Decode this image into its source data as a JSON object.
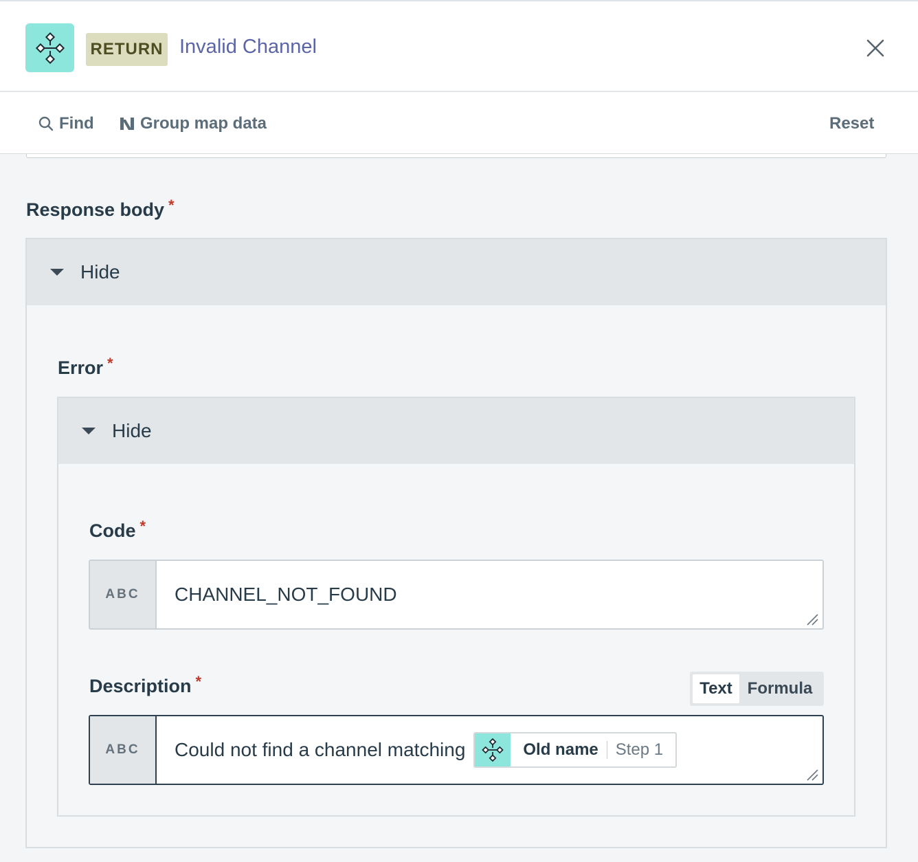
{
  "header": {
    "badge": "RETURN",
    "title": "Invalid Channel"
  },
  "toolbar": {
    "find_label": "Find",
    "group_label": "Group map data",
    "reset_label": "Reset"
  },
  "response_body": {
    "label": "Response body",
    "required_mark": "*",
    "toggle_label": "Hide",
    "error": {
      "label": "Error",
      "required_mark": "*",
      "toggle_label": "Hide",
      "code": {
        "label": "Code",
        "required_mark": "*",
        "type_tag": "ABC",
        "value": "CHANNEL_NOT_FOUND"
      },
      "description": {
        "label": "Description",
        "required_mark": "*",
        "type_tag": "ABC",
        "mode_options": [
          "Text",
          "Formula"
        ],
        "selected_mode": "Text",
        "value_text": "Could not find a channel matching",
        "pill": {
          "field_name": "Old name",
          "step": "Step 1"
        }
      }
    }
  },
  "colors": {
    "accent_teal": "#8de6dc",
    "title_link": "#5c64a8",
    "badge_bg": "#dcdcbf",
    "required": "#c0392b"
  },
  "icons": {
    "app": "workflow-diagram-icon",
    "close": "close-icon",
    "find": "search-icon",
    "group": "group-map-icon",
    "collapse": "caret-down-icon"
  }
}
